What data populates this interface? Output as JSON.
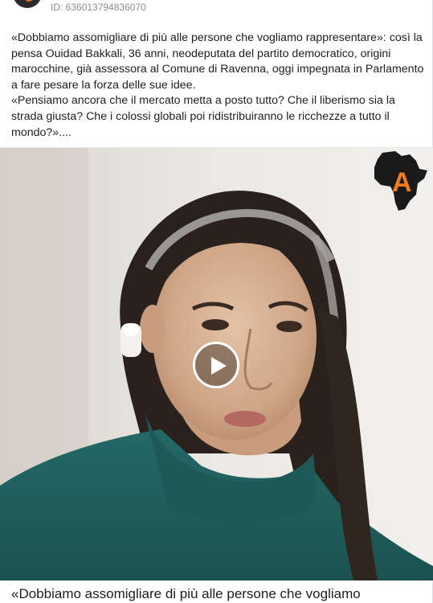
{
  "post": {
    "id_text": "ID: 636013794836070",
    "paragraph1": "«Dobbiamo assomigliare di più alle persone che vogliamo rappresentare»: così la pensa Ouidad Bakkali, 36 anni, neodeputata del partito democratico, origini marocchine, già assessora al Comune di Ravenna, oggi impegnata in Parlamento a fare pesare la forza delle sue idee.",
    "paragraph2": "«Pensiamo ancora che il mercato metta a posto tutto? Che il liberismo sia la strada giusta? Che i colossi globali poi ridistribuiranno le ricchezze a tutto il mondo?»...."
  },
  "video": {
    "logo_letter": "A",
    "logo_colors": {
      "continent": "#1a1a1a",
      "letter": "#f07c1f"
    },
    "play_icon": "play-icon"
  },
  "caption": {
    "text": "«Dobbiamo assomigliare di più alle persone che vogliamo"
  },
  "colors": {
    "accent": "#e5671f",
    "sweater": "#1f5e5c",
    "text": "#1c1e21",
    "muted": "#8a8d91"
  }
}
